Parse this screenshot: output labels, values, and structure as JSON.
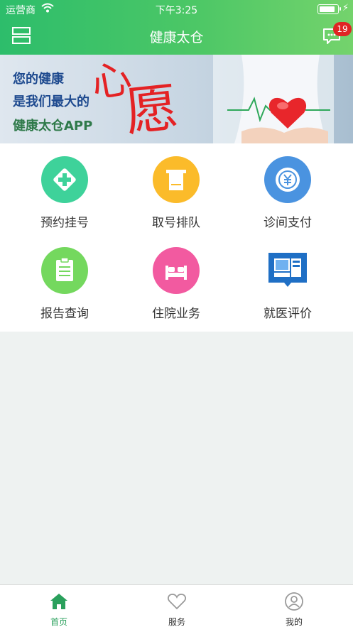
{
  "status_bar": {
    "carrier": "运营商",
    "time": "下午3:25",
    "battery_level": 0.9
  },
  "header": {
    "title": "健康太仓",
    "message_badge": "19"
  },
  "banner": {
    "line1": "您的健康",
    "line2": "是我们最大的",
    "line3": "健康太仓APP",
    "big_char1": "心",
    "big_char2": "愿"
  },
  "services": [
    {
      "label": "预约挂号",
      "icon": "appointment-icon",
      "color": "#3ed29a"
    },
    {
      "label": "取号排队",
      "icon": "ticket-icon",
      "color": "#fbbb2a"
    },
    {
      "label": "诊间支付",
      "icon": "payment-icon",
      "color": "#4a93e0"
    },
    {
      "label": "报告查询",
      "icon": "report-icon",
      "color": "#74d85e"
    },
    {
      "label": "住院业务",
      "icon": "hospital-bed-icon",
      "color": "#f25aa0"
    },
    {
      "label": "就医评价",
      "icon": "evaluation-icon",
      "color": "#1f6fc5"
    }
  ],
  "tabbar": {
    "tabs": [
      {
        "label": "首页",
        "icon": "home-icon",
        "active": true
      },
      {
        "label": "服务",
        "icon": "heart-icon",
        "active": false
      },
      {
        "label": "我的",
        "icon": "profile-icon",
        "active": false
      }
    ]
  },
  "colors": {
    "brand_green": "#3cc26a",
    "badge_red": "#e02424",
    "active_tab": "#2aa05c"
  }
}
